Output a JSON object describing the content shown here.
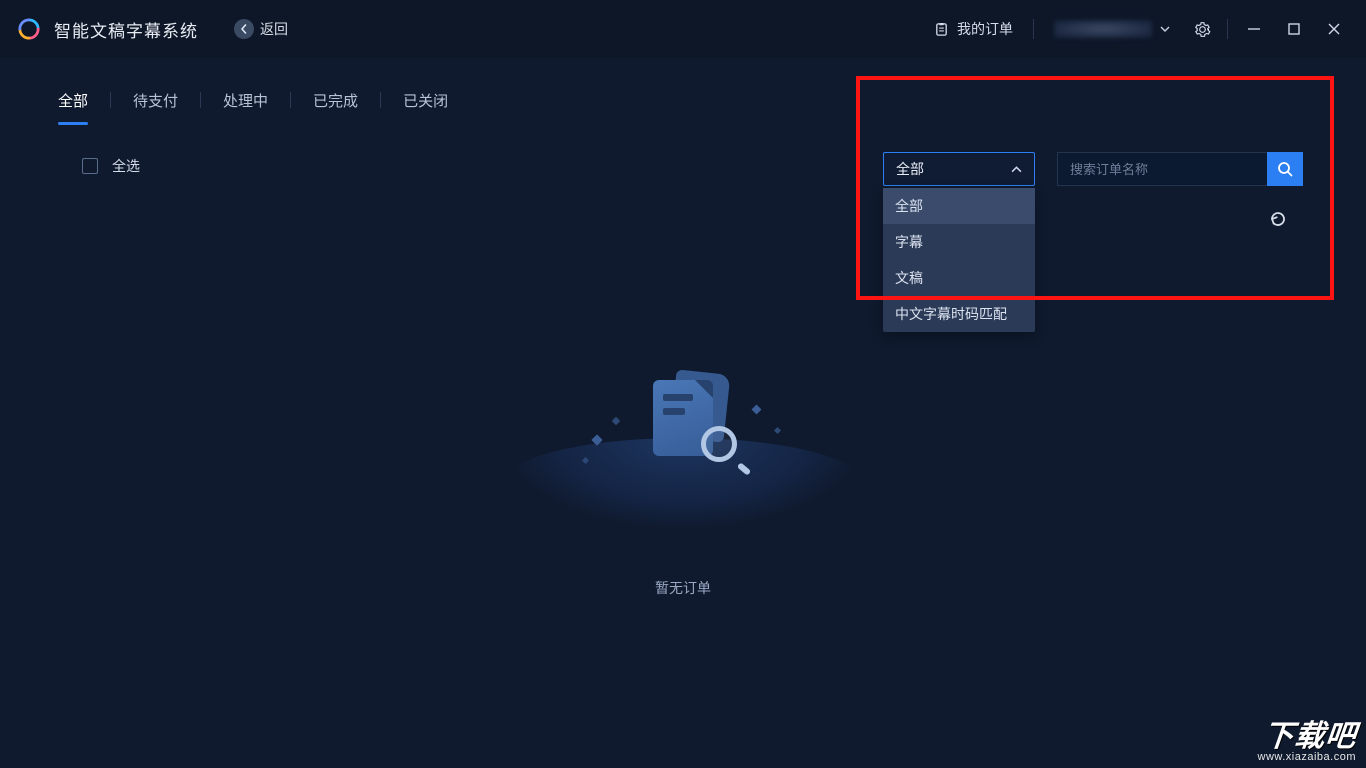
{
  "header": {
    "app_title": "智能文稿字幕系统",
    "back_label": "返回",
    "my_orders_label": "我的订单"
  },
  "tabs": [
    {
      "label": "全部",
      "active": true
    },
    {
      "label": "待支付",
      "active": false
    },
    {
      "label": "处理中",
      "active": false
    },
    {
      "label": "已完成",
      "active": false
    },
    {
      "label": "已关闭",
      "active": false
    }
  ],
  "select_all_label": "全选",
  "filter": {
    "selected": "全部",
    "options": [
      "全部",
      "字幕",
      "文稿",
      "中文字幕时码匹配"
    ]
  },
  "search": {
    "placeholder": "搜索订单名称",
    "value": ""
  },
  "empty_state_text": "暂无订单",
  "watermark": {
    "main": "下载吧",
    "url": "www.xiazaiba.com"
  },
  "colors": {
    "accent": "#2c7ff2",
    "highlight_border": "#ff1414"
  }
}
